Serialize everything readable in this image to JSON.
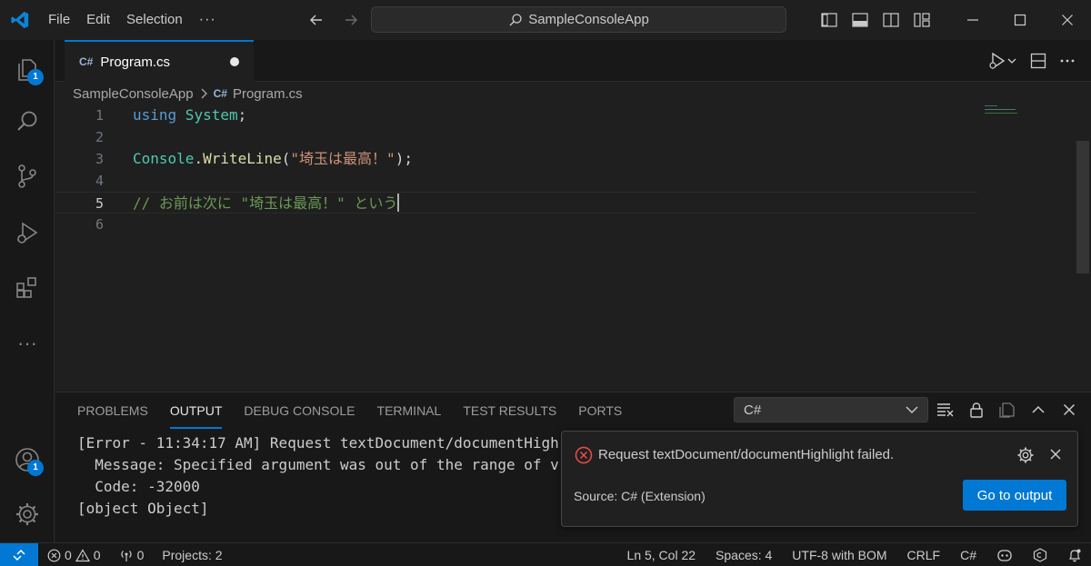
{
  "titlebar": {
    "menu": [
      "File",
      "Edit",
      "Selection"
    ],
    "more": "···",
    "search_text": "SampleConsoleApp"
  },
  "activitybar": {
    "explorer_badge": "1",
    "accounts_badge": "1",
    "more": "···"
  },
  "tab": {
    "filename": "Program.cs",
    "icon_text": "C#"
  },
  "breadcrumb": {
    "project": "SampleConsoleApp",
    "file": "Program.cs"
  },
  "editor": {
    "line_numbers": [
      "1",
      "2",
      "3",
      "4",
      "5",
      "6"
    ],
    "line1": {
      "kw": "using",
      "type": " System",
      "plain": ";"
    },
    "line3": {
      "type": "Console",
      "plain1": ".",
      "method": "WriteLine",
      "plain2": "(",
      "str": "\"埼玉は最高！\"",
      "plain3": ");"
    },
    "line5": {
      "comment": "// お前は次に \"埼玉は最高！\" という"
    }
  },
  "panel": {
    "tabs": [
      "PROBLEMS",
      "OUTPUT",
      "DEBUG CONSOLE",
      "TERMINAL",
      "TEST RESULTS",
      "PORTS"
    ],
    "active_tab": "OUTPUT",
    "channel": "C#",
    "output_lines": [
      "[Error - 11:34:17 AM] Request textDocument/documentHigh",
      "  Message: Specified argument was out of the range of v",
      "  Code: -32000",
      "[object Object]"
    ]
  },
  "notification": {
    "message": "Request textDocument/documentHighlight failed.",
    "source": "Source: C# (Extension)",
    "button": "Go to output"
  },
  "statusbar": {
    "errors": "0",
    "warnings": "0",
    "ports": "0",
    "projects": "Projects: 2",
    "position": "Ln 5, Col 22",
    "spaces": "Spaces: 4",
    "encoding": "UTF-8 with BOM",
    "eol": "CRLF",
    "language": "C#"
  },
  "colors": {
    "accent": "#0078d4",
    "error": "#f14c4c"
  }
}
